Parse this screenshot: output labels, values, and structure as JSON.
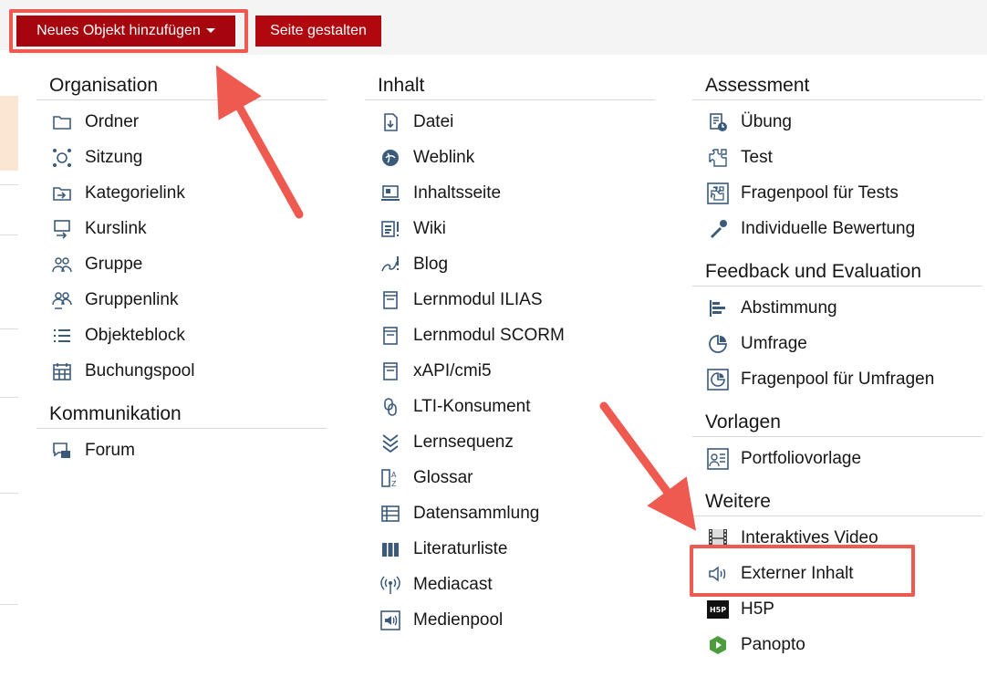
{
  "toolbar": {
    "add_label": "Neues Objekt hinzufügen",
    "design_label": "Seite gestalten"
  },
  "columns": [
    {
      "groups": [
        {
          "title": "Organisation",
          "items": [
            {
              "label": "Ordner",
              "icon": "folder-icon"
            },
            {
              "label": "Sitzung",
              "icon": "session-icon"
            },
            {
              "label": "Kategorielink",
              "icon": "category-link-icon"
            },
            {
              "label": "Kurslink",
              "icon": "course-link-icon"
            },
            {
              "label": "Gruppe",
              "icon": "group-icon"
            },
            {
              "label": "Gruppenlink",
              "icon": "group-link-icon"
            },
            {
              "label": "Objekteblock",
              "icon": "list-block-icon"
            },
            {
              "label": "Buchungspool",
              "icon": "calendar-icon"
            }
          ]
        },
        {
          "title": "Kommunikation",
          "items": [
            {
              "label": "Forum",
              "icon": "forum-icon"
            }
          ]
        }
      ]
    },
    {
      "groups": [
        {
          "title": "Inhalt",
          "items": [
            {
              "label": "Datei",
              "icon": "file-icon"
            },
            {
              "label": "Weblink",
              "icon": "weblink-icon"
            },
            {
              "label": "Inhaltsseite",
              "icon": "content-page-icon"
            },
            {
              "label": "Wiki",
              "icon": "wiki-icon"
            },
            {
              "label": "Blog",
              "icon": "blog-icon"
            },
            {
              "label": "Lernmodul ILIAS",
              "icon": "learning-module-icon"
            },
            {
              "label": "Lernmodul SCORM",
              "icon": "scorm-icon"
            },
            {
              "label": "xAPI/cmi5",
              "icon": "xapi-icon"
            },
            {
              "label": "LTI-Konsument",
              "icon": "lti-icon"
            },
            {
              "label": "Lernsequenz",
              "icon": "sequence-icon"
            },
            {
              "label": "Glossar",
              "icon": "glossary-icon"
            },
            {
              "label": "Datensammlung",
              "icon": "data-collection-icon"
            },
            {
              "label": "Literaturliste",
              "icon": "bibliography-icon"
            },
            {
              "label": "Mediacast",
              "icon": "mediacast-icon"
            },
            {
              "label": "Medienpool",
              "icon": "media-pool-icon"
            }
          ]
        }
      ]
    },
    {
      "groups": [
        {
          "title": "Assessment",
          "items": [
            {
              "label": "Übung",
              "icon": "exercise-icon"
            },
            {
              "label": "Test",
              "icon": "test-icon"
            },
            {
              "label": "Fragenpool für Tests",
              "icon": "question-pool-icon"
            },
            {
              "label": "Individuelle Bewertung",
              "icon": "assessment-icon"
            }
          ]
        },
        {
          "title": "Feedback und Evaluation",
          "items": [
            {
              "label": "Abstimmung",
              "icon": "poll-icon"
            },
            {
              "label": "Umfrage",
              "icon": "survey-icon"
            },
            {
              "label": "Fragenpool für Umfragen",
              "icon": "survey-pool-icon"
            }
          ]
        },
        {
          "title": "Vorlagen",
          "items": [
            {
              "label": "Portfoliovorlage",
              "icon": "portfolio-template-icon"
            }
          ]
        },
        {
          "title": "Weitere",
          "items": [
            {
              "label": "Interaktives Video",
              "icon": "film-icon"
            },
            {
              "label": "Externer Inhalt",
              "icon": "speaker-icon"
            },
            {
              "label": "H5P",
              "icon": "h5p-icon",
              "icon_text": "H5P"
            },
            {
              "label": "Panopto",
              "icon": "panopto-icon"
            }
          ]
        }
      ]
    }
  ],
  "colors": {
    "button_red": "#a6050d",
    "highlight": "#ef5a50",
    "icon": "#3a5a7c"
  }
}
